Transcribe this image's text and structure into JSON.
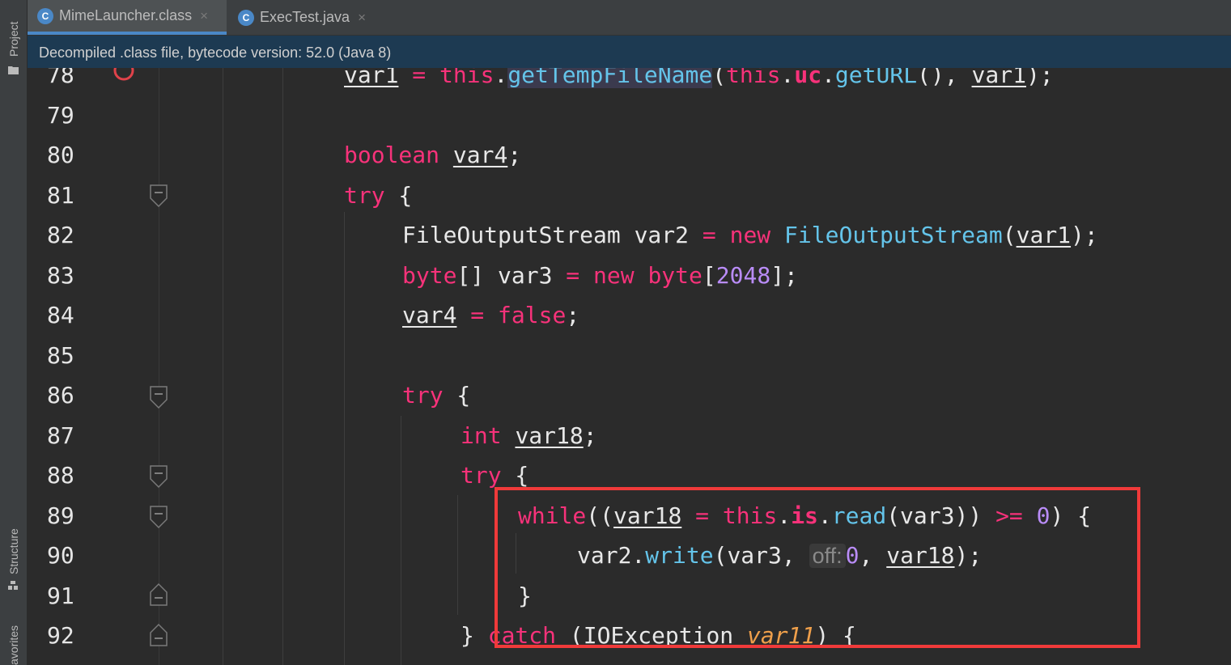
{
  "sidebar": {
    "project_label": "Project",
    "structure_label": "Structure",
    "favorites_label": "avorites"
  },
  "tabs": [
    {
      "label": "MimeLauncher.class",
      "icon": "class-icon",
      "icon_letter": "C",
      "close": "×",
      "active": true
    },
    {
      "label": "ExecTest.java",
      "icon": "java-class-icon",
      "icon_letter": "C",
      "close": "×",
      "active": false
    }
  ],
  "banner": {
    "text": "Decompiled .class file, bytecode version: 52.0 (Java 8)"
  },
  "editor": {
    "line_numbers": [
      "78",
      "79",
      "80",
      "81",
      "82",
      "83",
      "84",
      "85",
      "86",
      "87",
      "88",
      "89",
      "90",
      "91",
      "92"
    ],
    "hint_off": "off:",
    "tokens": {
      "l78": {
        "var1": "var1",
        "eq": " = ",
        "this": "this",
        "dot": ".",
        "getTemp": "getTempFileName",
        "open": "(",
        "this2": "this",
        "dot2": ".",
        "uc": "uc",
        "dot3": ".",
        "getURL": "getURL",
        "args": "(), ",
        "var1b": "var1",
        "end": ");"
      },
      "l80": {
        "kw": "boolean",
        "sp": " ",
        "var4": "var4",
        "end": ";"
      },
      "l81": {
        "kw": "try",
        "end": " {"
      },
      "l82": {
        "type": "FileOutputStream var2 ",
        "eq": "= ",
        "new": "new ",
        "cls": "FileOutputStream",
        "open": "(",
        "var1": "var1",
        "end": ");"
      },
      "l83": {
        "byte": "byte",
        "mid": "[] var3 ",
        "eq": "= ",
        "new": "new ",
        "byte2": "byte",
        "open": "[",
        "num": "2048",
        "end": "];"
      },
      "l84": {
        "var4": "var4",
        "eq": " = ",
        "false": "false",
        "end": ";"
      },
      "l86": {
        "kw": "try",
        "end": " {"
      },
      "l87": {
        "kw": "int",
        "sp": " ",
        "var18": "var18",
        "end": ";"
      },
      "l88": {
        "kw": "try",
        "end": " {"
      },
      "l89": {
        "while": "while",
        "open": "((",
        "var18": "var18",
        "eq": " = ",
        "this": "this",
        "dot": ".",
        "is": "is",
        "dot2": ".",
        "read": "read",
        "args": "(var3)) ",
        "ge": ">=",
        "sp": " ",
        "zero": "0",
        "end": ") {"
      },
      "l90": {
        "pre": "var2.",
        "write": "write",
        "args": "(var3, ",
        "zero": "0",
        "comma": ", ",
        "var18": "var18",
        "end": ");"
      },
      "l91": {
        "brace": "}"
      },
      "l92": {
        "brace": "} ",
        "catch": "catch",
        "open": " (IOException ",
        "var11": "var11",
        "end": ") {"
      }
    }
  },
  "colors": {
    "keyword": "#f7327a",
    "function": "#64c4ea",
    "number": "#b98cf7",
    "param": "#f0a04b",
    "highlight_box": "#f03a3a",
    "banner_bg": "#1d3a52"
  }
}
